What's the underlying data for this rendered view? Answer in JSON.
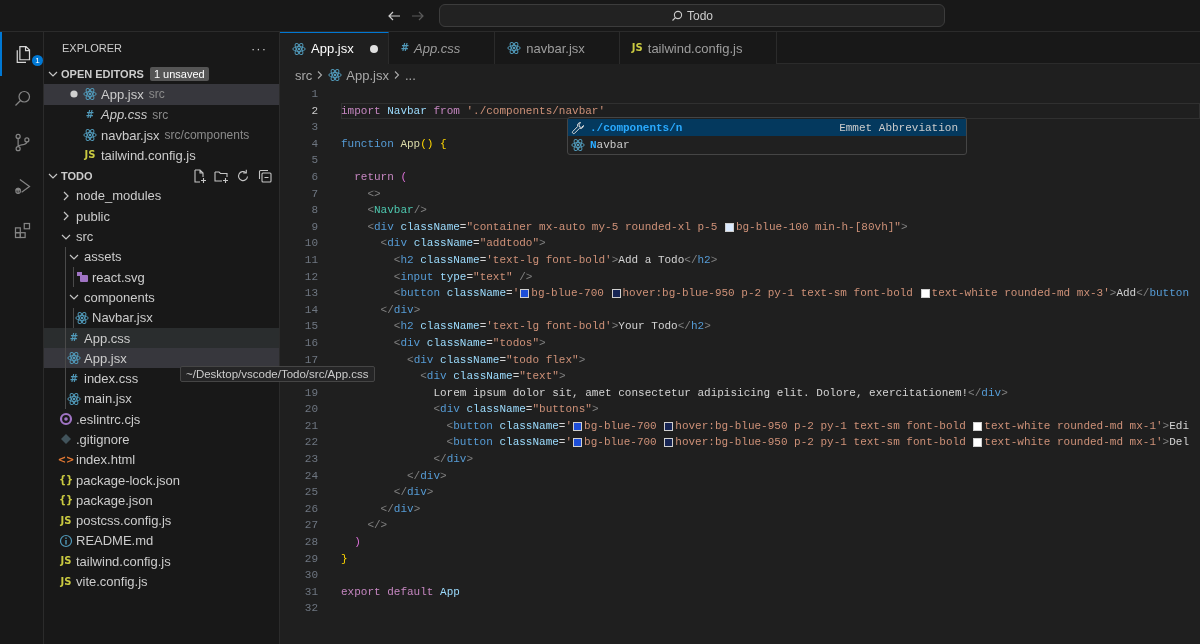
{
  "title_bar": {
    "nav": [
      {
        "kind": "back",
        "disabled": false
      },
      {
        "kind": "forward",
        "disabled": true
      }
    ],
    "command_center": "Todo"
  },
  "activity_bar": [
    {
      "kind": "explorer",
      "selected": true,
      "badge": "1"
    },
    {
      "kind": "search",
      "selected": false
    },
    {
      "kind": "source-control",
      "selected": false
    },
    {
      "kind": "run-debug",
      "selected": false
    },
    {
      "kind": "extensions",
      "selected": false
    }
  ],
  "sidebar": {
    "title": "EXPLORER",
    "more": "···",
    "open_editors": {
      "title": "OPEN EDITORS",
      "expanded": true,
      "badge": "1 unsaved",
      "items": [
        {
          "name": "App.jsx",
          "description": "src",
          "kind": "react",
          "dirty": true,
          "preview": false,
          "selected": true
        },
        {
          "name": "App.css",
          "description": "src",
          "kind": "css",
          "icon_text": "#",
          "dirty": false,
          "preview": true,
          "selected": false
        },
        {
          "name": "navbar.jsx",
          "description": "src/components",
          "kind": "react",
          "dirty": false,
          "preview": false,
          "selected": false
        },
        {
          "name": "tailwind.config.js",
          "kind": "js",
          "icon_text": "JS",
          "dirty": false,
          "preview": false,
          "selected": false
        }
      ]
    },
    "folder": {
      "title": "TODO",
      "expanded": true,
      "actions": [
        {
          "kind": "new-file"
        },
        {
          "kind": "new-folder"
        },
        {
          "kind": "refresh"
        },
        {
          "kind": "collapse"
        }
      ],
      "items": [
        {
          "name": "node_modules",
          "kind": "folder",
          "expanded": false,
          "selected": false,
          "hovered": false
        },
        {
          "name": "public",
          "kind": "folder",
          "expanded": false,
          "selected": false,
          "hovered": false
        },
        {
          "name": "src",
          "kind": "folder",
          "expanded": true,
          "selected": false,
          "hovered": false,
          "children": [
            {
              "name": "assets",
              "kind": "folder",
              "expanded": true,
              "selected": false,
              "hovered": false,
              "children": [
                {
                  "name": "react.svg",
                  "kind": "svg",
                  "selected": false,
                  "hovered": false
                }
              ]
            },
            {
              "name": "components",
              "kind": "folder",
              "expanded": true,
              "selected": false,
              "hovered": false,
              "children": [
                {
                  "name": "Navbar.jsx",
                  "kind": "react",
                  "selected": false,
                  "hovered": false
                }
              ]
            },
            {
              "name": "App.css",
              "kind": "css",
              "icon_text": "#",
              "selected": false,
              "hovered": true
            },
            {
              "name": "App.jsx",
              "kind": "react",
              "selected": true,
              "hovered": false
            },
            {
              "name": "index.css",
              "kind": "css",
              "icon_text": "#",
              "selected": false,
              "hovered": false
            },
            {
              "name": "main.jsx",
              "kind": "react",
              "selected": false,
              "hovered": false
            }
          ]
        },
        {
          "name": ".eslintrc.cjs",
          "kind": "eslint",
          "selected": false,
          "hovered": false
        },
        {
          "name": ".gitignore",
          "kind": "git",
          "selected": false,
          "hovered": false
        },
        {
          "name": "index.html",
          "kind": "html",
          "icon_text": "<>",
          "selected": false,
          "hovered": false
        },
        {
          "name": "package-lock.json",
          "kind": "json",
          "icon_text": "{}",
          "selected": false,
          "hovered": false
        },
        {
          "name": "package.json",
          "kind": "json",
          "icon_text": "{}",
          "selected": false,
          "hovered": false
        },
        {
          "name": "postcss.config.js",
          "kind": "js",
          "icon_text": "JS",
          "selected": false,
          "hovered": false
        },
        {
          "name": "README.md",
          "kind": "readme",
          "selected": false,
          "hovered": false
        },
        {
          "name": "tailwind.config.js",
          "kind": "js",
          "icon_text": "JS",
          "selected": false,
          "hovered": false
        },
        {
          "name": "vite.config.js",
          "kind": "js",
          "icon_text": "JS",
          "selected": false,
          "hovered": false
        }
      ]
    }
  },
  "tooltip": "~/Desktop/vscode/Todo/src/App.css",
  "editor": {
    "tabs": [
      {
        "label": "App.jsx",
        "kind": "react",
        "selected": true,
        "dirty": true,
        "preview": false
      },
      {
        "label": "App.css",
        "kind": "css",
        "icon_text": "#",
        "selected": false,
        "dirty": false,
        "preview": true
      },
      {
        "label": "navbar.jsx",
        "kind": "react",
        "selected": false,
        "dirty": false,
        "preview": false
      },
      {
        "label": "tailwind.config.js",
        "kind": "js",
        "icon_text": "JS",
        "selected": false,
        "dirty": false,
        "preview": false
      }
    ],
    "breadcrumb": [
      {
        "label": "src"
      },
      {
        "label": "App.jsx",
        "kind": "react"
      },
      {
        "label": "..."
      }
    ],
    "lines": [
      {
        "n": "1",
        "current": false
      },
      {
        "n": "2",
        "current": true,
        "tokens": [
          {
            "kind": "kw",
            "text": "import "
          },
          {
            "kind": "var",
            "text": "Navbar "
          },
          {
            "kind": "kw",
            "text": "from "
          },
          {
            "kind": "str",
            "text": "'./components/navbar'"
          }
        ]
      },
      {
        "n": "3",
        "current": false
      },
      {
        "n": "4",
        "current": false,
        "tokens": [
          {
            "kind": "st",
            "text": "function "
          },
          {
            "kind": "fn",
            "text": "App"
          },
          {
            "kind": "br",
            "text": "() {"
          }
        ]
      },
      {
        "n": "5",
        "current": false
      },
      {
        "n": "6",
        "current": false,
        "tokens": [
          {
            "kind": "kw",
            "text": "  return "
          },
          {
            "kind": "br2",
            "text": "("
          }
        ]
      },
      {
        "n": "7",
        "current": false,
        "tokens": [
          {
            "kind": "pu",
            "text": "    <>"
          }
        ]
      },
      {
        "n": "8",
        "current": false,
        "tokens": [
          {
            "kind": "pu",
            "text": "    <"
          },
          {
            "kind": "cmp",
            "text": "Navbar"
          },
          {
            "kind": "pu",
            "text": "/>"
          }
        ]
      },
      {
        "n": "9",
        "current": false,
        "tokens": [
          {
            "kind": "pu",
            "text": "    <"
          },
          {
            "kind": "tag",
            "text": "div "
          },
          {
            "kind": "attr",
            "text": "className"
          },
          {
            "kind": "tx",
            "text": "="
          },
          {
            "kind": "str",
            "text": "\"container mx-auto my-5 rounded-xl p-5 "
          },
          {
            "kind": "sw",
            "color": "#dbeafe"
          },
          {
            "kind": "str",
            "text": "bg-blue-100 min-h-[80vh]\""
          },
          {
            "kind": "pu",
            "text": ">"
          }
        ]
      },
      {
        "n": "10",
        "current": false,
        "tokens": [
          {
            "kind": "pu",
            "text": "      <"
          },
          {
            "kind": "tag",
            "text": "div "
          },
          {
            "kind": "attr",
            "text": "className"
          },
          {
            "kind": "tx",
            "text": "="
          },
          {
            "kind": "str",
            "text": "\"addtodo\""
          },
          {
            "kind": "pu",
            "text": ">"
          }
        ]
      },
      {
        "n": "11",
        "current": false,
        "tokens": [
          {
            "kind": "pu",
            "text": "        <"
          },
          {
            "kind": "tag",
            "text": "h2 "
          },
          {
            "kind": "attr",
            "text": "className"
          },
          {
            "kind": "tx",
            "text": "="
          },
          {
            "kind": "str",
            "text": "'text-lg font-bold'"
          },
          {
            "kind": "pu",
            "text": ">"
          },
          {
            "kind": "tx",
            "text": "Add a Todo"
          },
          {
            "kind": "pu",
            "text": "</"
          },
          {
            "kind": "tag",
            "text": "h2"
          },
          {
            "kind": "pu",
            "text": ">"
          }
        ]
      },
      {
        "n": "12",
        "current": false,
        "tokens": [
          {
            "kind": "pu",
            "text": "        <"
          },
          {
            "kind": "tag",
            "text": "input "
          },
          {
            "kind": "attr",
            "text": "type"
          },
          {
            "kind": "tx",
            "text": "="
          },
          {
            "kind": "str",
            "text": "\"text\" "
          },
          {
            "kind": "pu",
            "text": "/>"
          }
        ]
      },
      {
        "n": "13",
        "current": false,
        "tokens": [
          {
            "kind": "pu",
            "text": "        <"
          },
          {
            "kind": "tag",
            "text": "button "
          },
          {
            "kind": "attr",
            "text": "className"
          },
          {
            "kind": "tx",
            "text": "="
          },
          {
            "kind": "str",
            "text": "'"
          },
          {
            "kind": "sw",
            "color": "#1d4ed8"
          },
          {
            "kind": "str",
            "text": "bg-blue-700 "
          },
          {
            "kind": "sw",
            "color": "#172554"
          },
          {
            "kind": "str",
            "text": "hover:bg-blue-950 p-2 py-1 text-sm font-bold "
          },
          {
            "kind": "sw",
            "color": "#ffffff"
          },
          {
            "kind": "str",
            "text": "text-white rounded-md mx-3'"
          },
          {
            "kind": "pu",
            "text": ">"
          },
          {
            "kind": "tx",
            "text": "Add"
          },
          {
            "kind": "pu",
            "text": "</"
          },
          {
            "kind": "tag",
            "text": "button"
          }
        ]
      },
      {
        "n": "14",
        "current": false,
        "tokens": [
          {
            "kind": "pu",
            "text": "      </"
          },
          {
            "kind": "tag",
            "text": "div"
          },
          {
            "kind": "pu",
            "text": ">"
          }
        ]
      },
      {
        "n": "15",
        "current": false,
        "tokens": [
          {
            "kind": "pu",
            "text": "        <"
          },
          {
            "kind": "tag",
            "text": "h2 "
          },
          {
            "kind": "attr",
            "text": "className"
          },
          {
            "kind": "tx",
            "text": "="
          },
          {
            "kind": "str",
            "text": "'text-lg font-bold'"
          },
          {
            "kind": "pu",
            "text": ">"
          },
          {
            "kind": "tx",
            "text": "Your Todo"
          },
          {
            "kind": "pu",
            "text": "</"
          },
          {
            "kind": "tag",
            "text": "h2"
          },
          {
            "kind": "pu",
            "text": ">"
          }
        ]
      },
      {
        "n": "16",
        "current": false,
        "tokens": [
          {
            "kind": "pu",
            "text": "        <"
          },
          {
            "kind": "tag",
            "text": "div "
          },
          {
            "kind": "attr",
            "text": "className"
          },
          {
            "kind": "tx",
            "text": "="
          },
          {
            "kind": "str",
            "text": "\"todos\""
          },
          {
            "kind": "pu",
            "text": ">"
          }
        ]
      },
      {
        "n": "17",
        "current": false,
        "tokens": [
          {
            "kind": "pu",
            "text": "          <"
          },
          {
            "kind": "tag",
            "text": "div "
          },
          {
            "kind": "attr",
            "text": "className"
          },
          {
            "kind": "tx",
            "text": "="
          },
          {
            "kind": "str",
            "text": "\"todo flex\""
          },
          {
            "kind": "pu",
            "text": ">"
          }
        ]
      },
      {
        "current": false,
        "tokens": [
          {
            "kind": "pu",
            "text": "            <"
          },
          {
            "kind": "tag",
            "text": "div "
          },
          {
            "kind": "attr",
            "text": "className"
          },
          {
            "kind": "tx",
            "text": "="
          },
          {
            "kind": "str",
            "text": "\"text\""
          },
          {
            "kind": "pu",
            "text": ">"
          }
        ]
      },
      {
        "n": "19",
        "current": false,
        "tokens": [
          {
            "kind": "tx",
            "text": "              Lorem ipsum dolor sit, amet consectetur adipisicing elit. Dolore, exercitationem!"
          },
          {
            "kind": "pu",
            "text": "</"
          },
          {
            "kind": "tag",
            "text": "div"
          },
          {
            "kind": "pu",
            "text": ">"
          }
        ]
      },
      {
        "n": "20",
        "current": false,
        "tokens": [
          {
            "kind": "pu",
            "text": "              <"
          },
          {
            "kind": "tag",
            "text": "div "
          },
          {
            "kind": "attr",
            "text": "className"
          },
          {
            "kind": "tx",
            "text": "="
          },
          {
            "kind": "str",
            "text": "\"buttons\""
          },
          {
            "kind": "pu",
            "text": ">"
          }
        ]
      },
      {
        "n": "21",
        "current": false,
        "tokens": [
          {
            "kind": "pu",
            "text": "                <"
          },
          {
            "kind": "tag",
            "text": "button "
          },
          {
            "kind": "attr",
            "text": "className"
          },
          {
            "kind": "tx",
            "text": "="
          },
          {
            "kind": "str",
            "text": "'"
          },
          {
            "kind": "sw",
            "color": "#1d4ed8"
          },
          {
            "kind": "str",
            "text": "bg-blue-700 "
          },
          {
            "kind": "sw",
            "color": "#172554"
          },
          {
            "kind": "str",
            "text": "hover:bg-blue-950 p-2 py-1 text-sm font-bold "
          },
          {
            "kind": "sw",
            "color": "#ffffff"
          },
          {
            "kind": "str",
            "text": "text-white rounded-md mx-1'"
          },
          {
            "kind": "pu",
            "text": ">"
          },
          {
            "kind": "tx",
            "text": "Edi"
          }
        ]
      },
      {
        "n": "22",
        "current": false,
        "tokens": [
          {
            "kind": "pu",
            "text": "                <"
          },
          {
            "kind": "tag",
            "text": "button "
          },
          {
            "kind": "attr",
            "text": "className"
          },
          {
            "kind": "tx",
            "text": "="
          },
          {
            "kind": "str",
            "text": "'"
          },
          {
            "kind": "sw",
            "color": "#1d4ed8"
          },
          {
            "kind": "str",
            "text": "bg-blue-700 "
          },
          {
            "kind": "sw",
            "color": "#172554"
          },
          {
            "kind": "str",
            "text": "hover:bg-blue-950 p-2 py-1 text-sm font-bold "
          },
          {
            "kind": "sw",
            "color": "#ffffff"
          },
          {
            "kind": "str",
            "text": "text-white rounded-md mx-1'"
          },
          {
            "kind": "pu",
            "text": ">"
          },
          {
            "kind": "tx",
            "text": "Del"
          }
        ]
      },
      {
        "n": "23",
        "current": false,
        "tokens": [
          {
            "kind": "pu",
            "text": "              </"
          },
          {
            "kind": "tag",
            "text": "div"
          },
          {
            "kind": "pu",
            "text": ">"
          }
        ]
      },
      {
        "n": "24",
        "current": false,
        "tokens": [
          {
            "kind": "pu",
            "text": "          </"
          },
          {
            "kind": "tag",
            "text": "div"
          },
          {
            "kind": "pu",
            "text": ">"
          }
        ]
      },
      {
        "n": "25",
        "current": false,
        "tokens": [
          {
            "kind": "pu",
            "text": "        </"
          },
          {
            "kind": "tag",
            "text": "div"
          },
          {
            "kind": "pu",
            "text": ">"
          }
        ]
      },
      {
        "n": "26",
        "current": false,
        "tokens": [
          {
            "kind": "pu",
            "text": "      </"
          },
          {
            "kind": "tag",
            "text": "div"
          },
          {
            "kind": "pu",
            "text": ">"
          }
        ]
      },
      {
        "n": "27",
        "current": false,
        "tokens": [
          {
            "kind": "pu",
            "text": "    </>"
          }
        ]
      },
      {
        "n": "28",
        "current": false,
        "tokens": [
          {
            "kind": "br2",
            "text": "  )"
          }
        ]
      },
      {
        "n": "29",
        "current": false,
        "tokens": [
          {
            "kind": "br",
            "text": "}"
          }
        ]
      },
      {
        "n": "30",
        "current": false
      },
      {
        "n": "31",
        "current": false,
        "tokens": [
          {
            "kind": "kw",
            "text": "export default "
          },
          {
            "kind": "var",
            "text": "App"
          }
        ]
      },
      {
        "n": "32",
        "current": false
      }
    ],
    "suggest": {
      "items": [
        {
          "kind": "emmet",
          "match": "./components/n",
          "detail": "Emmet Abbreviation",
          "selected": true
        },
        {
          "kind": "react",
          "match": "N",
          "rest": "avbar",
          "selected": false
        }
      ]
    }
  }
}
